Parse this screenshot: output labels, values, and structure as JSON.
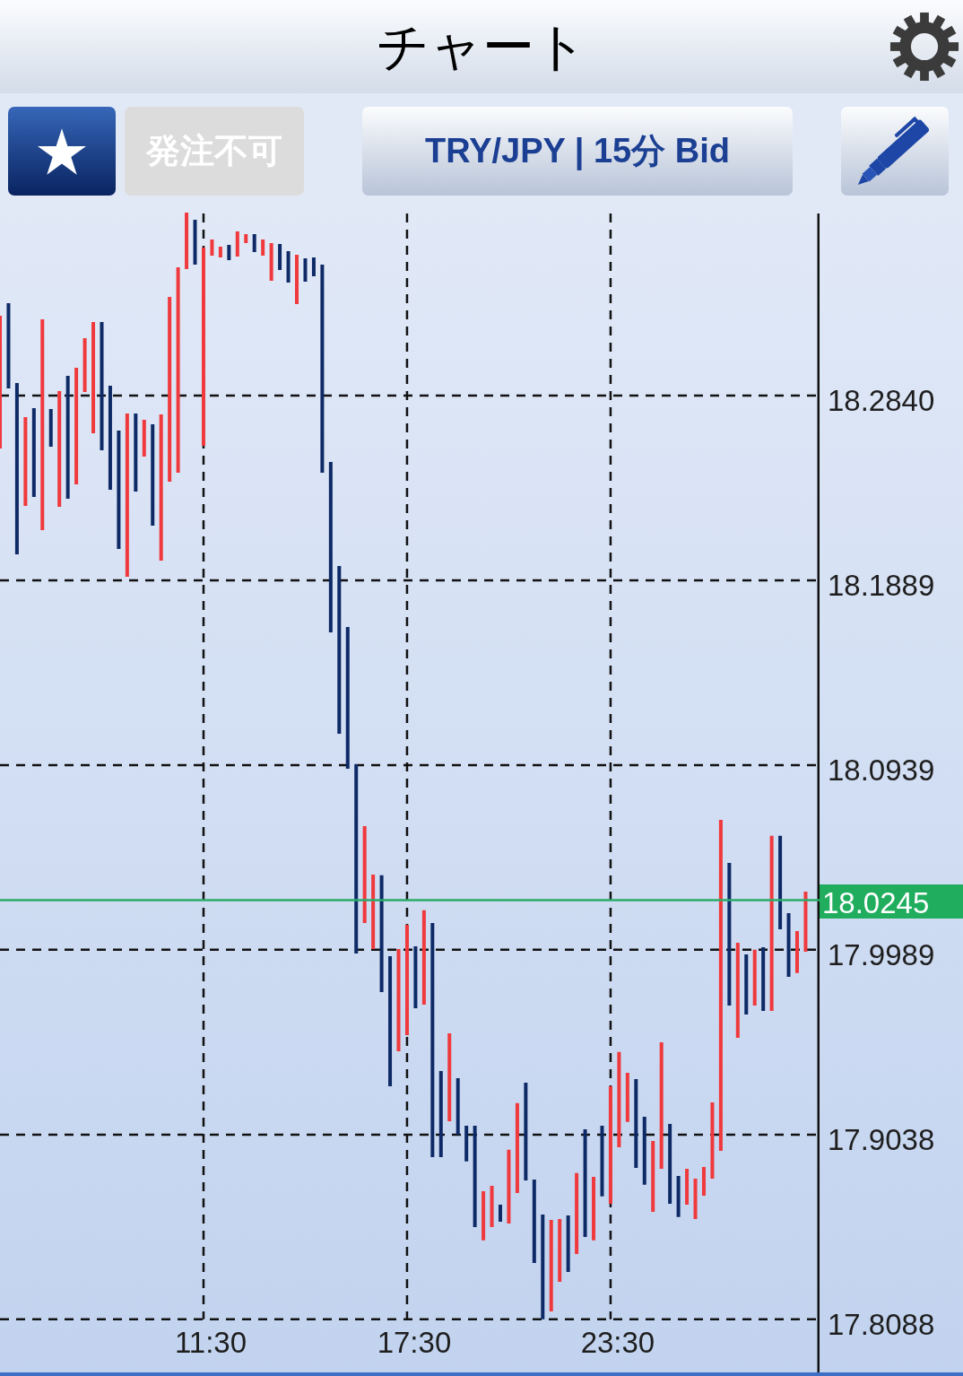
{
  "header": {
    "title": "チャート"
  },
  "toolbar": {
    "order_button": {
      "label": "発注不可",
      "disabled": true
    },
    "symbol_button": {
      "label": "TRY/JPY | 15分 Bid"
    }
  },
  "chart": {
    "chart_data": {
      "type": "candlestick",
      "grid": true,
      "xlim": [
        5.5,
        33.89
      ],
      "ylim": [
        17.7815,
        18.3786
      ],
      "xticks": [
        {
          "value": 11.5,
          "label": "11:30"
        },
        {
          "value": 17.5,
          "label": "17:30"
        },
        {
          "value": 23.5,
          "label": "23:30"
        }
      ],
      "yticks": [
        {
          "value": 18.284,
          "label": "18.2840"
        },
        {
          "value": 18.1889,
          "label": "18.1889"
        },
        {
          "value": 18.0939,
          "label": "18.0939"
        },
        {
          "value": 17.9989,
          "label": "17.9989"
        },
        {
          "value": 17.9038,
          "label": "17.9038"
        },
        {
          "value": 17.8088,
          "label": "17.8088"
        }
      ],
      "x": [
        5.5,
        5.75,
        6,
        6.25,
        6.5,
        6.75,
        7,
        7.25,
        7.5,
        7.75,
        8,
        8.25,
        8.5,
        8.75,
        9,
        9.25,
        9.5,
        9.75,
        10,
        10.25,
        10.5,
        10.75,
        11,
        11.25,
        11.5,
        11.75,
        12,
        12.25,
        12.5,
        12.75,
        13,
        13.25,
        13.5,
        13.75,
        14,
        14.25,
        14.5,
        14.75,
        15,
        15.25,
        15.5,
        15.75,
        16,
        16.25,
        16.5,
        16.75,
        17,
        17.25,
        17.5,
        17.75,
        18,
        18.25,
        18.5,
        18.75,
        19,
        19.25,
        19.5,
        19.75,
        20,
        20.25,
        20.5,
        20.75,
        21,
        21.25,
        21.5,
        21.75,
        22,
        22.25,
        22.5,
        22.75,
        23,
        23.25,
        23.5,
        23.75,
        24,
        24.25,
        24.5,
        24.75,
        25,
        25.25,
        25.5,
        25.75,
        26,
        26.25,
        26.5,
        26.75,
        27,
        27.25,
        27.5,
        27.75,
        28,
        28.25,
        28.5,
        28.75,
        29,
        29.25
      ],
      "ohlc": [
        [
          18.2568,
          18.3251,
          18.2568,
          18.3251
        ],
        [
          18.3315,
          18.3315,
          18.2877,
          18.2877
        ],
        [
          18.2905,
          18.2905,
          18.2023,
          18.2023
        ],
        [
          18.2272,
          18.2729,
          18.2272,
          18.2729
        ],
        [
          18.2775,
          18.2775,
          18.2319,
          18.2319
        ],
        [
          18.2148,
          18.3232,
          18.2148,
          18.3232
        ],
        [
          18.2771,
          18.2771,
          18.2577,
          18.2577
        ],
        [
          18.2268,
          18.2863,
          18.2268,
          18.2863
        ],
        [
          18.2942,
          18.2942,
          18.2309,
          18.2309
        ],
        [
          18.2383,
          18.2983,
          18.2383,
          18.2983
        ],
        [
          18.2858,
          18.3135,
          18.2858,
          18.3135
        ],
        [
          18.2646,
          18.3218,
          18.2646,
          18.3218
        ],
        [
          18.3218,
          18.3218,
          18.2559,
          18.2559
        ],
        [
          18.2891,
          18.2891,
          18.2356,
          18.2356
        ],
        [
          18.266,
          18.266,
          18.2051,
          18.2051
        ],
        [
          18.1908,
          18.2748,
          18.1908,
          18.2748
        ],
        [
          18.2748,
          18.2748,
          18.2346,
          18.2346
        ],
        [
          18.2526,
          18.2715,
          18.2526,
          18.2715
        ],
        [
          18.2692,
          18.2692,
          18.2171,
          18.2171
        ],
        [
          18.1991,
          18.2743,
          18.1991,
          18.2743
        ],
        [
          18.2397,
          18.3348,
          18.2397,
          18.3348
        ],
        [
          18.2443,
          18.35,
          18.2443,
          18.35
        ],
        [
          18.3491,
          18.3781,
          18.3491,
          18.3781
        ],
        [
          18.3744,
          18.3744,
          18.3514,
          18.3514
        ],
        [
          18.2582,
          18.3601,
          18.2582,
          18.3601
        ],
        [
          18.356,
          18.3643,
          18.356,
          18.3643
        ],
        [
          18.3551,
          18.3606,
          18.3551,
          18.3606
        ],
        [
          18.3615,
          18.3615,
          18.3537,
          18.3537
        ],
        [
          18.3555,
          18.3684,
          18.3555,
          18.3684
        ],
        [
          18.3624,
          18.3671,
          18.3624,
          18.3671
        ],
        [
          18.3671,
          18.3671,
          18.3578,
          18.3578
        ],
        [
          18.356,
          18.3643,
          18.356,
          18.3643
        ],
        [
          18.3431,
          18.3624,
          18.3431,
          18.3624
        ],
        [
          18.362,
          18.362,
          18.3486,
          18.3486
        ],
        [
          18.3583,
          18.3583,
          18.3421,
          18.3421
        ],
        [
          18.3311,
          18.3564,
          18.3311,
          18.3564
        ],
        [
          18.3546,
          18.3546,
          18.3426,
          18.3426
        ],
        [
          18.3551,
          18.3551,
          18.3454,
          18.3454
        ],
        [
          18.3514,
          18.3514,
          18.2443,
          18.2443
        ],
        [
          18.2499,
          18.2499,
          18.1622,
          18.1622
        ],
        [
          18.1963,
          18.1963,
          18.1101,
          18.1101
        ],
        [
          18.165,
          18.165,
          18.0921,
          18.0921
        ],
        [
          18.0944,
          18.0944,
          17.997,
          17.997
        ],
        [
          18.0127,
          18.0625,
          18.0127,
          18.0625
        ],
        [
          17.9993,
          18.0376,
          17.9993,
          18.0376
        ],
        [
          18.0372,
          18.0372,
          17.9772,
          17.9772
        ],
        [
          17.9956,
          17.9956,
          17.9287,
          17.9287
        ],
        [
          17.9467,
          17.9993,
          17.9467,
          17.9993
        ],
        [
          17.955,
          18.0118,
          17.955,
          18.0118
        ],
        [
          18.0007,
          18.0007,
          17.9689,
          17.9689
        ],
        [
          17.9707,
          18.0192,
          17.9707,
          18.0192
        ],
        [
          18.0127,
          18.0127,
          17.8923,
          17.8923
        ],
        [
          17.9366,
          17.9366,
          17.8923,
          17.8923
        ],
        [
          17.9107,
          17.9559,
          17.9107,
          17.9559
        ],
        [
          17.9329,
          17.9329,
          17.9038,
          17.9038
        ],
        [
          17.9084,
          17.9084,
          17.89,
          17.89
        ],
        [
          17.9084,
          17.9084,
          17.8563,
          17.8563
        ],
        [
          17.8494,
          17.8747,
          17.8494,
          17.8747
        ],
        [
          17.8563,
          17.8775,
          17.8563,
          17.8775
        ],
        [
          17.8678,
          17.8678,
          17.859,
          17.859
        ],
        [
          17.8581,
          17.896,
          17.8581,
          17.896
        ],
        [
          17.8738,
          17.92,
          17.8738,
          17.92
        ],
        [
          17.9306,
          17.9306,
          17.8803,
          17.8803
        ],
        [
          17.8807,
          17.8807,
          17.8378,
          17.8378
        ],
        [
          17.8627,
          17.8627,
          17.8088,
          17.8088
        ],
        [
          17.8129,
          17.86,
          17.8129,
          17.86
        ],
        [
          17.8281,
          17.8604,
          17.8281,
          17.8604
        ],
        [
          17.8623,
          17.8623,
          17.8332,
          17.8332
        ],
        [
          17.8424,
          17.884,
          17.8424,
          17.884
        ],
        [
          17.9066,
          17.9066,
          17.8512,
          17.8512
        ],
        [
          17.8494,
          17.8821,
          17.8494,
          17.8821
        ],
        [
          17.9084,
          17.9084,
          17.872,
          17.872
        ],
        [
          17.8683,
          17.9287,
          17.8683,
          17.9287
        ],
        [
          17.8973,
          17.9463,
          17.8973,
          17.9463
        ],
        [
          17.9103,
          17.9356,
          17.9103,
          17.9356
        ],
        [
          17.9324,
          17.9324,
          17.8867,
          17.8867
        ],
        [
          17.913,
          17.913,
          17.878,
          17.878
        ],
        [
          17.8641,
          17.9006,
          17.8641,
          17.9006
        ],
        [
          17.8863,
          17.9513,
          17.8863,
          17.9513
        ],
        [
          17.9093,
          17.9093,
          17.8683,
          17.8683
        ],
        [
          17.8826,
          17.8826,
          17.8614,
          17.8614
        ],
        [
          17.8678,
          17.8863,
          17.8678,
          17.8863
        ],
        [
          17.8604,
          17.8812,
          17.8604,
          17.8812
        ],
        [
          17.8724,
          17.8872,
          17.8724,
          17.8872
        ],
        [
          17.8812,
          17.9204,
          17.8812,
          17.9204
        ],
        [
          17.8955,
          18.0658,
          17.8955,
          18.0658
        ],
        [
          18.0436,
          18.0436,
          17.9702,
          17.9702
        ],
        [
          17.9536,
          18.0025,
          17.9536,
          18.0025
        ],
        [
          17.9965,
          17.9965,
          17.9656,
          17.9656
        ],
        [
          17.9702,
          17.9989,
          17.9702,
          17.9989
        ],
        [
          18.0002,
          18.0002,
          17.9675,
          17.9675
        ],
        [
          17.9675,
          18.0575,
          17.9675,
          18.0575
        ],
        [
          18.0575,
          18.0575,
          18.0095,
          18.0095
        ],
        [
          18.0178,
          18.0178,
          17.985,
          17.985
        ],
        [
          17.9869,
          18.0085,
          17.9869,
          18.0085
        ],
        [
          17.9979,
          18.0288,
          17.9979,
          18.0288
        ]
      ],
      "ref_lines": [
        {
          "axis": "y",
          "value": 18.0245,
          "label": "18.0245"
        }
      ]
    }
  }
}
